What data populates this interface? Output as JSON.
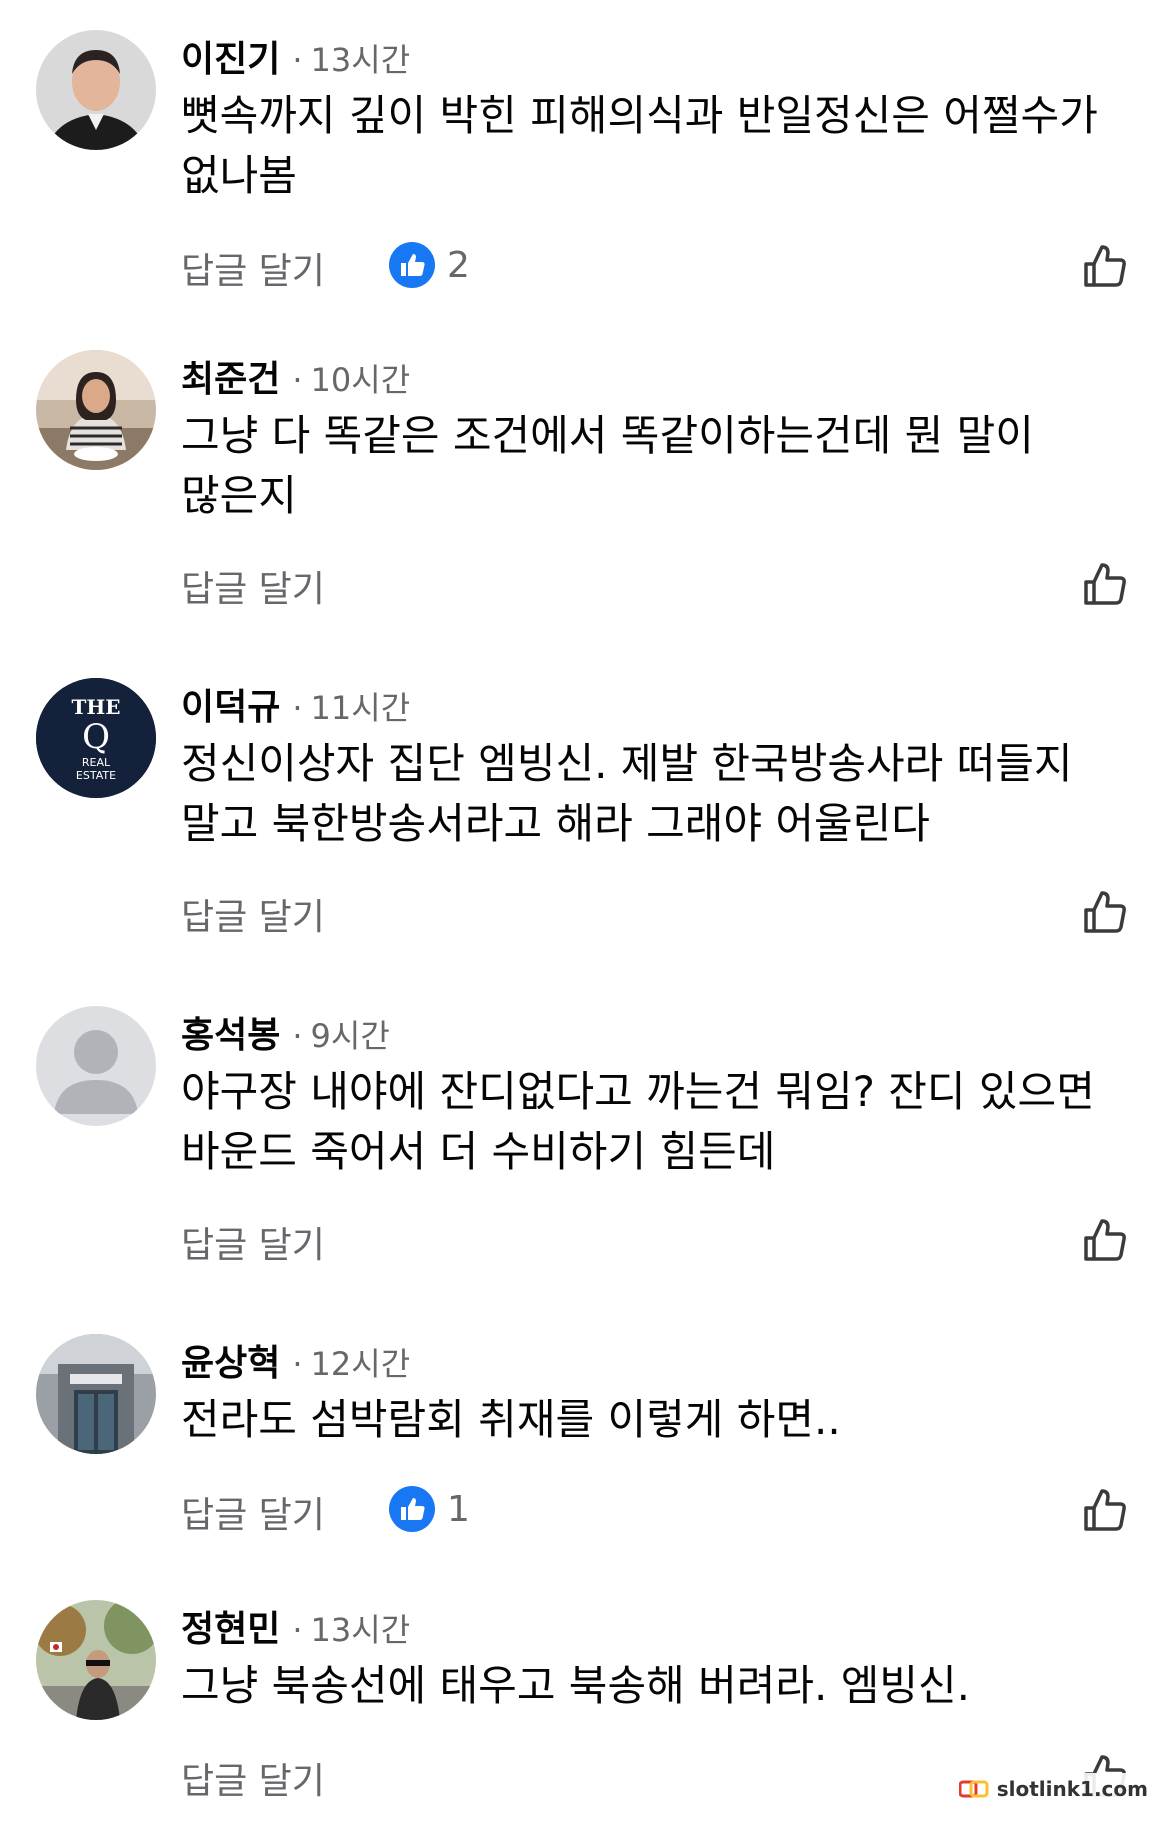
{
  "ui": {
    "reply_label": "답글 달기"
  },
  "colors": {
    "text_primary": "#050505",
    "text_secondary": "#65676b",
    "like_blue": "#1877f2",
    "like_outline": "#3a3b3c"
  },
  "comments": [
    {
      "author": "이진기",
      "time": "13시간",
      "text": "뼛속까지 깊이 박힌 피해의식과 반일정신은 어쩔수가 없나봄",
      "reaction_count": "2",
      "avatar": "photo-man-suit"
    },
    {
      "author": "최준건",
      "time": "10시간",
      "text": "그냥 다 똑같은 조건에서 똑같이하는건데 뭔 말이 많은지",
      "reaction_count": null,
      "avatar": "photo-woman-table"
    },
    {
      "author": "이덕규",
      "time": "11시간",
      "text": "정신이상자 집단 엠빙신. 제발 한국방송사라 떠들지 말고 북한방송서라고 해라 그래야 어울린다",
      "reaction_count": null,
      "avatar": "logo-the-q-real-estate",
      "avatar_text": {
        "line1": "THE",
        "line2": "Q",
        "line3": "REAL",
        "line4": "ESTATE"
      }
    },
    {
      "author": "홍석봉",
      "time": "9시간",
      "text": "야구장 내야에 잔디없다고 까는건 뭐임? 잔디 있으면 바운드 죽어서 더 수비하기 힘든데",
      "reaction_count": null,
      "avatar": "default-person-icon"
    },
    {
      "author": "윤상혁",
      "time": "12시간",
      "text": "전라도 섬박람회 취재를 이렇게 하면..",
      "reaction_count": "1",
      "avatar": "photo-building-entrance"
    },
    {
      "author": "정현민",
      "time": "13시간",
      "text": "그냥 북송선에 태우고 북송해 버려라. 엠빙신.",
      "reaction_count": null,
      "avatar": "photo-man-outdoors"
    }
  ],
  "watermark": {
    "text": "slotlink1.com"
  }
}
